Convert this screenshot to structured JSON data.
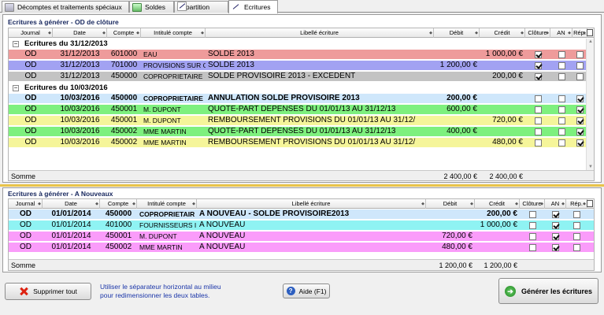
{
  "tabs": [
    "Décomptes et traitements spéciaux",
    "Soldes",
    "Répartition",
    "Ecritures"
  ],
  "columns": {
    "journal": "Journal",
    "date": "Date",
    "compte": "Compte",
    "intitule": "Intitulé compte",
    "libelle": "Libellé écriture",
    "debit": "Débit",
    "credit": "Crédit",
    "cloture": "Clôture",
    "an": "AN",
    "rep": "Rép."
  },
  "cloture_section": {
    "title": "Ecritures à générer - OD de clôture",
    "groups": [
      {
        "label": "Ecritures du 31/12/2013",
        "rows": [
          {
            "journal": "OD",
            "date": "31/12/2013",
            "compte": "601000",
            "intitule": "EAU",
            "libelle": "SOLDE 2013",
            "debit": "",
            "credit": "1 000,00 €",
            "cloture": true,
            "an": false,
            "rep": false,
            "color": "#ee9b9b"
          },
          {
            "journal": "OD",
            "date": "31/12/2013",
            "compte": "701000",
            "intitule": "PROVISIONS SUR C",
            "libelle": "SOLDE 2013",
            "debit": "1 200,00 €",
            "credit": "",
            "cloture": true,
            "an": false,
            "rep": false,
            "color": "#a2a2f2"
          },
          {
            "journal": "OD",
            "date": "31/12/2013",
            "compte": "450000",
            "intitule": "COPROPRIETAIRE",
            "libelle": "SOLDE PROVISOIRE 2013 - EXCEDENT",
            "debit": "",
            "credit": "200,00 €",
            "cloture": true,
            "an": false,
            "rep": false,
            "color": "#c3c3c3"
          }
        ]
      },
      {
        "label": "Ecritures du 10/03/2016",
        "rows": [
          {
            "journal": "OD",
            "date": "10/03/2016",
            "compte": "450000",
            "intitule": "COPROPRIETAIRE",
            "libelle": "ANNULATION SOLDE PROVISOIRE 2013",
            "debit": "200,00 €",
            "credit": "",
            "cloture": false,
            "an": false,
            "rep": true,
            "color": "#cfe7fb",
            "bold": true
          },
          {
            "journal": "OD",
            "date": "10/03/2016",
            "compte": "450001",
            "intitule": "M. DUPONT",
            "libelle": "QUOTE-PART DEPENSES DU 01/01/13 AU 31/12/13",
            "debit": "600,00 €",
            "credit": "",
            "cloture": false,
            "an": false,
            "rep": true,
            "color": "#7ef07e"
          },
          {
            "journal": "OD",
            "date": "10/03/2016",
            "compte": "450001",
            "intitule": "M. DUPONT",
            "libelle": "REMBOURSEMENT PROVISIONS DU 01/01/13 AU 31/12/",
            "debit": "",
            "credit": "720,00 €",
            "cloture": false,
            "an": false,
            "rep": true,
            "color": "#f5f59a"
          },
          {
            "journal": "OD",
            "date": "10/03/2016",
            "compte": "450002",
            "intitule": "MME MARTIN",
            "libelle": "QUOTE-PART DEPENSES DU 01/01/13 AU 31/12/13",
            "debit": "400,00 €",
            "credit": "",
            "cloture": false,
            "an": false,
            "rep": true,
            "color": "#7ef07e"
          },
          {
            "journal": "OD",
            "date": "10/03/2016",
            "compte": "450002",
            "intitule": "MME MARTIN",
            "libelle": "REMBOURSEMENT PROVISIONS DU 01/01/13 AU 31/12/",
            "debit": "",
            "credit": "480,00 €",
            "cloture": false,
            "an": false,
            "rep": true,
            "color": "#f5f59a"
          }
        ]
      }
    ],
    "somme": {
      "label": "Somme",
      "debit": "2 400,00 €",
      "credit": "2 400,00 €"
    }
  },
  "an_section": {
    "title": "Ecritures à générer - A Nouveaux",
    "rows": [
      {
        "journal": "OD",
        "date": "01/01/2014",
        "compte": "450000",
        "intitule": "COPROPRIETAIR",
        "libelle": "A NOUVEAU - SOLDE PROVISOIRE2013",
        "debit": "",
        "credit": "200,00 €",
        "cloture": false,
        "an": true,
        "rep": false,
        "color": "#cfe7fb",
        "bold": true
      },
      {
        "journal": "OD",
        "date": "01/01/2014",
        "compte": "401000",
        "intitule": "FOURNISSEURS I",
        "libelle": "A NOUVEAU",
        "debit": "",
        "credit": "1 000,00 €",
        "cloture": false,
        "an": true,
        "rep": false,
        "color": "#8ff3f3"
      },
      {
        "journal": "OD",
        "date": "01/01/2014",
        "compte": "450001",
        "intitule": "M. DUPONT",
        "libelle": "A NOUVEAU",
        "debit": "720,00 €",
        "credit": "",
        "cloture": false,
        "an": true,
        "rep": false,
        "color": "#fa9cfa"
      },
      {
        "journal": "OD",
        "date": "01/01/2014",
        "compte": "450002",
        "intitule": "MME MARTIN",
        "libelle": "A NOUVEAU",
        "debit": "480,00 €",
        "credit": "",
        "cloture": false,
        "an": true,
        "rep": false,
        "color": "#fa9cfa"
      }
    ],
    "somme": {
      "label": "Somme",
      "debit": "1 200,00 €",
      "credit": "1 200,00 €"
    }
  },
  "footer": {
    "delete_all": "Supprimer tout",
    "hint_line1": "Utiliser le séparateur horizontal au milieu",
    "hint_line2": "pour redimensionner les deux tables.",
    "help": "Aide (F1)",
    "generate": "Générer les écritures"
  }
}
